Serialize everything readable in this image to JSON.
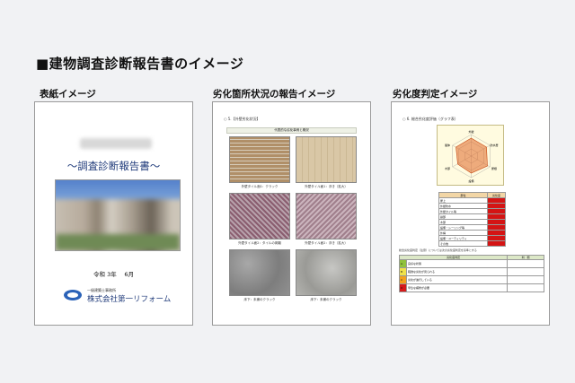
{
  "page_title": "■建物調査診断報告書のイメージ",
  "columns": {
    "cover": {
      "label": "表紙イメージ",
      "doc_title": "～調査診断報告書～",
      "date": "令和 3年　 6月",
      "company_small": "一級建築士事務所",
      "company_name": "株式会社第一リフォーム",
      "logo_color": "#2a62b8"
    },
    "status": {
      "label": "劣化箇所状況の報告イメージ",
      "section_title": "○ 5.【外壁劣化状況】",
      "table_header": "代表的な劣化事例と概況",
      "captions": [
        "外壁タイル面1：クラック",
        "外壁タイル面1：浮き（拡大）",
        "外壁タイル面2：タイルの剥離",
        "外壁タイル面2：浮き（拡大）",
        "床下：未補のクラック",
        "床下：未補のクラック"
      ]
    },
    "judgement": {
      "label": "劣化度判定イメージ",
      "section_title": "○ 6. 総合劣化度評価（グラフ表）",
      "radar_labels": [
        "外壁",
        "防水層",
        "屋根",
        "設備",
        "木部",
        "躯体"
      ],
      "table_headers": [
        "部位",
        "劣化度"
      ],
      "table_rows": [
        "屋上",
        "外壁防水",
        "外壁タイル等",
        "鉄部",
        "木部",
        "設備・シーリング等",
        "外構",
        "設備・ユーティリティ",
        "その他"
      ],
      "note": "総合劣化度判定（注意）については次の劣化度判定を基準とする",
      "grade_headers": [
        "劣化度判定",
        "判　断"
      ],
      "grades": [
        {
          "level": "A",
          "label": "良好な状態",
          "color": "#8fc23a"
        },
        {
          "level": "B",
          "label": "軽微な劣化が見られる",
          "color": "#f0e24a"
        },
        {
          "level": "C",
          "label": "劣化が進行している",
          "color": "#f3a21c"
        },
        {
          "level": "D",
          "label": "早急な補修が必要",
          "color": "#d61a1a"
        }
      ]
    }
  }
}
